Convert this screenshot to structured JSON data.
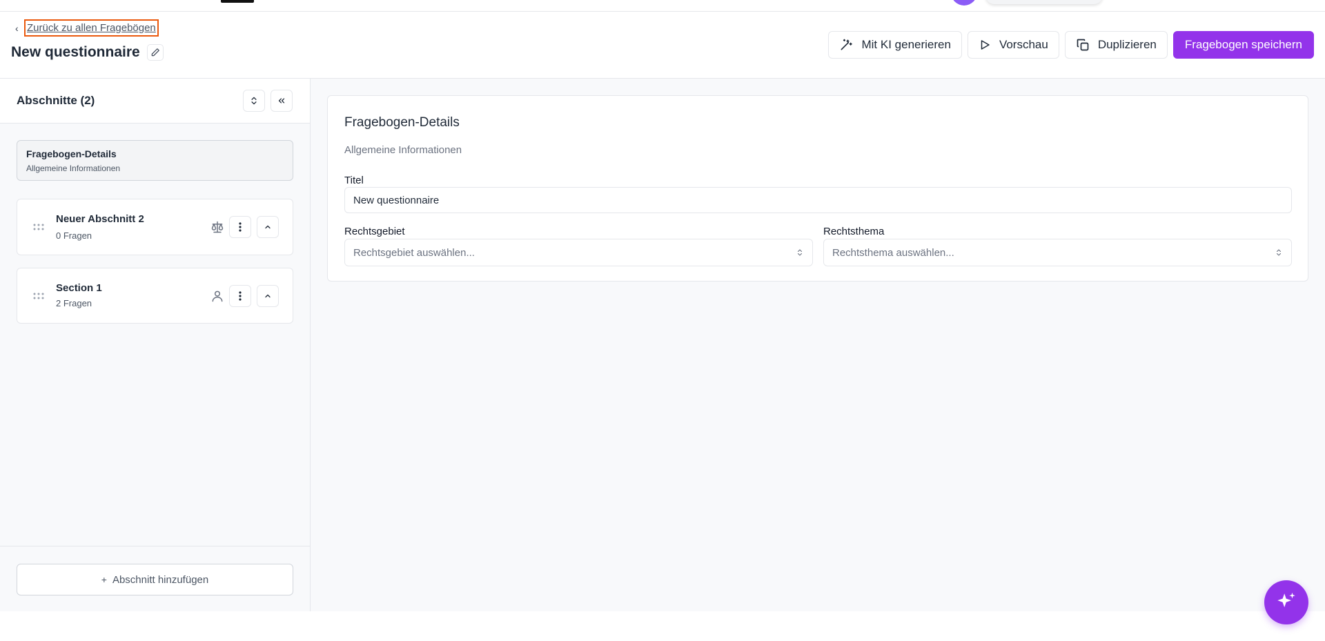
{
  "header": {
    "back_link": "Zurück zu allen Fragebögen",
    "title": "New questionnaire",
    "actions": {
      "ai_generate": "Mit KI generieren",
      "preview": "Vorschau",
      "duplicate": "Duplizieren",
      "save": "Fragebogen speichern"
    }
  },
  "sidebar": {
    "title": "Abschnitte (2)",
    "details": {
      "title": "Fragebogen-Details",
      "subtitle": "Allgemeine Informationen"
    },
    "sections": [
      {
        "name": "Neuer Abschnitt 2",
        "count": "0 Fragen",
        "icon": "scale-icon"
      },
      {
        "name": "Section 1",
        "count": "2 Fragen",
        "icon": "user-icon"
      }
    ],
    "add_section": "Abschnitt hinzufügen"
  },
  "main": {
    "panel_title": "Fragebogen-Details",
    "panel_subtitle": "Allgemeine Informationen",
    "title_label": "Titel",
    "title_value": "New questionnaire",
    "area_label": "Rechtsgebiet",
    "area_placeholder": "Rechtsgebiet auswählen...",
    "topic_label": "Rechtsthema",
    "topic_placeholder": "Rechtsthema auswählen..."
  },
  "colors": {
    "accent": "#9333ea",
    "focus_outline": "#ea580c"
  }
}
